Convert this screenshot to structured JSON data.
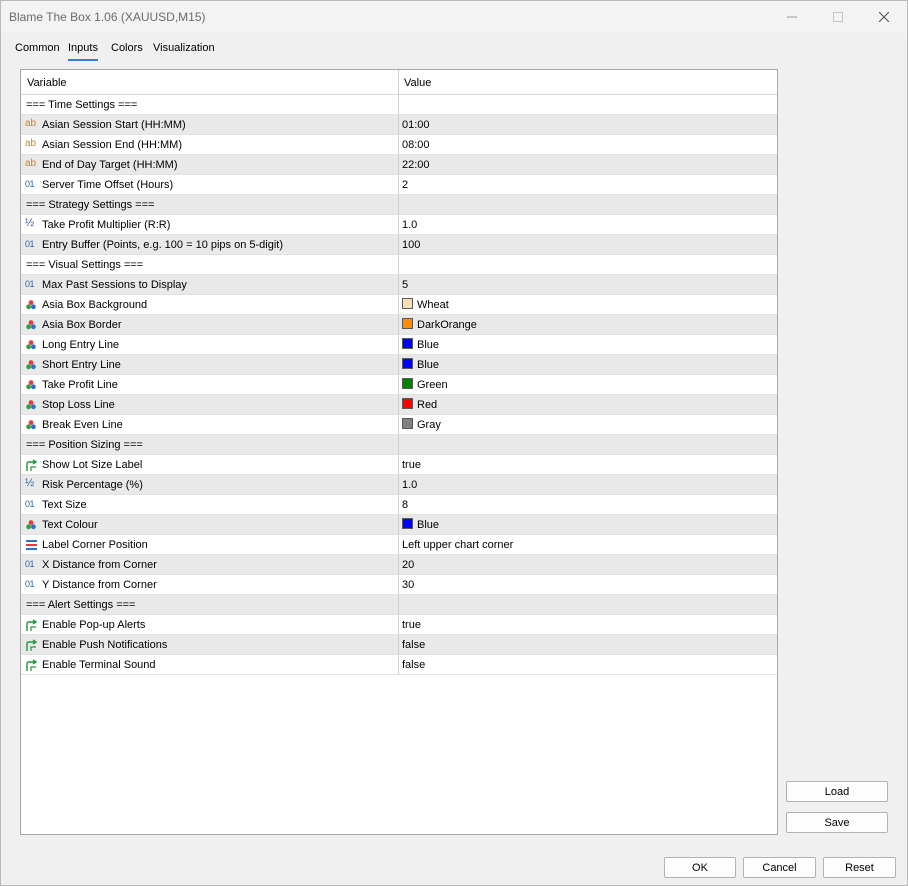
{
  "window": {
    "title": "Blame The Box 1.06 (XAUUSD,M15)",
    "minimize_glyph": "minimize-icon",
    "maximize_glyph": "maximize-icon",
    "close_glyph": "close-icon"
  },
  "tabs": [
    {
      "label": "Common",
      "active": false
    },
    {
      "label": "Inputs",
      "active": true
    },
    {
      "label": "Colors",
      "active": false
    },
    {
      "label": "Visualization",
      "active": false
    }
  ],
  "table": {
    "headers": {
      "variable": "Variable",
      "value": "Value"
    },
    "rows": [
      {
        "type": "section",
        "variable": "=== Time Settings ===",
        "value": ""
      },
      {
        "type": "string",
        "variable": "Asian Session Start (HH:MM)",
        "value": "01:00"
      },
      {
        "type": "string",
        "variable": "Asian Session End (HH:MM)",
        "value": "08:00"
      },
      {
        "type": "string",
        "variable": "End of Day Target (HH:MM)",
        "value": "22:00"
      },
      {
        "type": "int",
        "variable": "Server Time Offset (Hours)",
        "value": "2"
      },
      {
        "type": "section",
        "variable": "=== Strategy Settings ===",
        "value": ""
      },
      {
        "type": "double",
        "variable": "Take Profit Multiplier (R:R)",
        "value": "1.0"
      },
      {
        "type": "int",
        "variable": "Entry Buffer (Points, e.g. 100 = 10 pips on 5-digit)",
        "value": "100"
      },
      {
        "type": "section",
        "variable": "=== Visual Settings ===",
        "value": ""
      },
      {
        "type": "int",
        "variable": "Max Past Sessions to Display",
        "value": "5"
      },
      {
        "type": "color",
        "variable": "Asia Box Background",
        "value": "Wheat",
        "swatch": "#f5deb3"
      },
      {
        "type": "color",
        "variable": "Asia Box Border",
        "value": "DarkOrange",
        "swatch": "#ff8c00"
      },
      {
        "type": "color",
        "variable": "Long Entry Line",
        "value": "Blue",
        "swatch": "#0000ff"
      },
      {
        "type": "color",
        "variable": "Short Entry Line",
        "value": "Blue",
        "swatch": "#0000ff"
      },
      {
        "type": "color",
        "variable": "Take Profit Line",
        "value": "Green",
        "swatch": "#008000"
      },
      {
        "type": "color",
        "variable": "Stop Loss Line",
        "value": "Red",
        "swatch": "#ff0000"
      },
      {
        "type": "color",
        "variable": "Break Even Line",
        "value": "Gray",
        "swatch": "#808080"
      },
      {
        "type": "section",
        "variable": "=== Position Sizing ===",
        "value": ""
      },
      {
        "type": "bool",
        "variable": "Show Lot Size Label",
        "value": "true"
      },
      {
        "type": "double",
        "variable": "Risk Percentage (%)",
        "value": "1.0"
      },
      {
        "type": "int",
        "variable": "Text Size",
        "value": "8"
      },
      {
        "type": "color",
        "variable": "Text Colour",
        "value": "Blue",
        "swatch": "#0000ff"
      },
      {
        "type": "enum",
        "variable": "Label Corner Position",
        "value": "Left upper chart corner"
      },
      {
        "type": "int",
        "variable": "X Distance from Corner",
        "value": "20"
      },
      {
        "type": "int",
        "variable": "Y Distance from Corner",
        "value": "30"
      },
      {
        "type": "section",
        "variable": "=== Alert Settings ===",
        "value": ""
      },
      {
        "type": "bool",
        "variable": "Enable Pop-up Alerts",
        "value": "true"
      },
      {
        "type": "bool",
        "variable": "Enable Push Notifications",
        "value": "false"
      },
      {
        "type": "bool",
        "variable": "Enable Terminal Sound",
        "value": "false"
      }
    ]
  },
  "side_buttons": {
    "load": "Load",
    "save": "Save"
  },
  "footer_buttons": {
    "ok": "OK",
    "cancel": "Cancel",
    "reset": "Reset"
  },
  "icons": {
    "string": "ab-string-icon",
    "int": "integer-icon",
    "double": "fraction-icon",
    "color": "color-palette-icon",
    "bool": "boolean-arrow-icon",
    "enum": "enumeration-icon"
  },
  "colors": {
    "accent": "#3a7bd5",
    "alt_row": "#e9e9e9"
  }
}
